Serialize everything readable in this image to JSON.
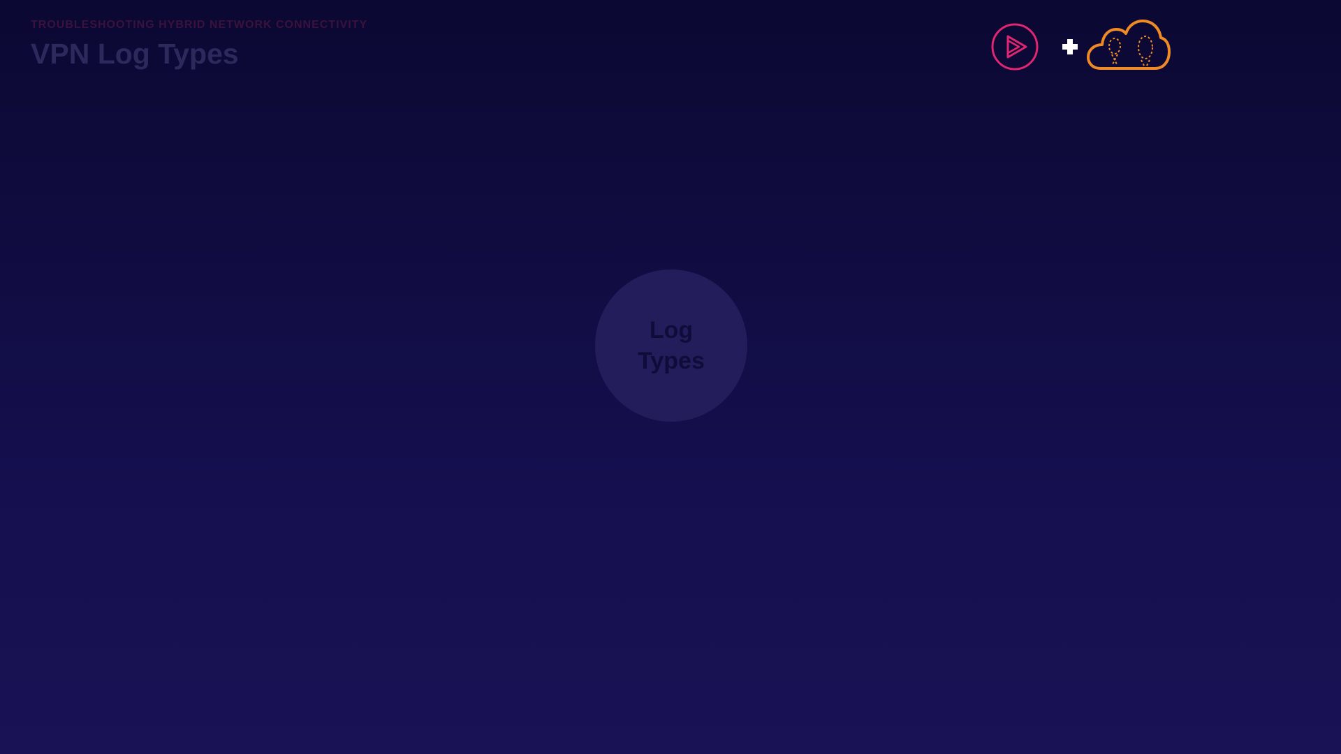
{
  "header": {
    "eyebrow": "TROUBLESHOOTING HYBRID NETWORK CONNECTIVITY",
    "title": "VPN Log Types"
  },
  "brand": {
    "wordmark": "",
    "logo_play_icon": "pluralsight-play-icon",
    "plus_icon": "plus-icon",
    "logo_cloud_icon": "acloudguru-cloud-icon",
    "colors": {
      "play": "#e02670",
      "cloud": "#f08a24",
      "plus": "#ffffff"
    }
  },
  "main": {
    "circle_label": "Log Types"
  },
  "colors": {
    "background_top": "#0b0833",
    "background_bottom": "#191355",
    "circle_fill": "#241d5c"
  }
}
